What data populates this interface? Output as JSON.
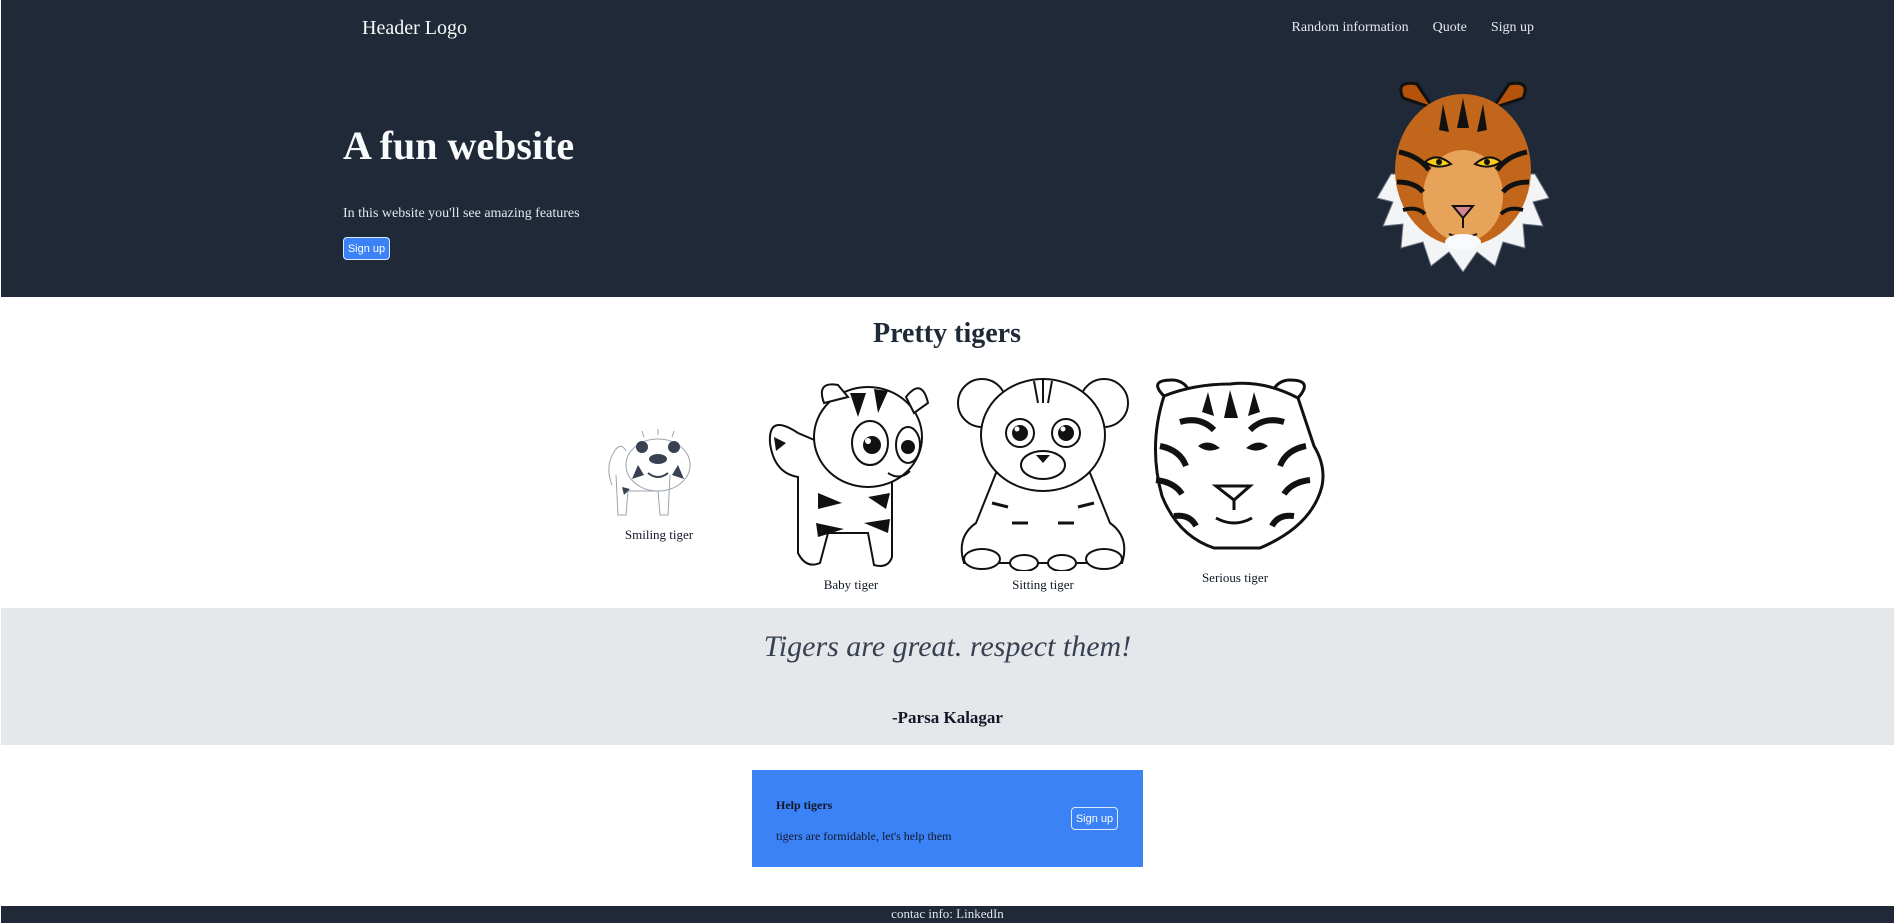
{
  "header": {
    "logo": "Header Logo",
    "nav": [
      "Random information",
      "Quote",
      "Sign up"
    ]
  },
  "hero": {
    "title": "A fun website",
    "subtitle": "In this website you'll see amazing features",
    "button_label": "Sign up",
    "image_icon": "tiger-face-icon"
  },
  "gallery": {
    "title": "Pretty tigers",
    "items": [
      {
        "caption": "Smiling tiger",
        "icon": "smiling-tiger-icon"
      },
      {
        "caption": "Baby tiger",
        "icon": "baby-tiger-icon"
      },
      {
        "caption": "Sitting tiger",
        "icon": "sitting-tiger-icon"
      },
      {
        "caption": "Serious tiger",
        "icon": "serious-tiger-icon"
      }
    ]
  },
  "quote": {
    "text": "Tigers are great. respect them!",
    "author": "-Parsa Kalagar"
  },
  "cta": {
    "title": "Help tigers",
    "text": "tigers are formidable, let's help them",
    "button_label": "Sign up"
  },
  "footer": {
    "text": "contac info: LinkedIn"
  },
  "colors": {
    "dark": "#1f2937",
    "accent": "#3b82f6",
    "band": "#e5e7eb"
  }
}
